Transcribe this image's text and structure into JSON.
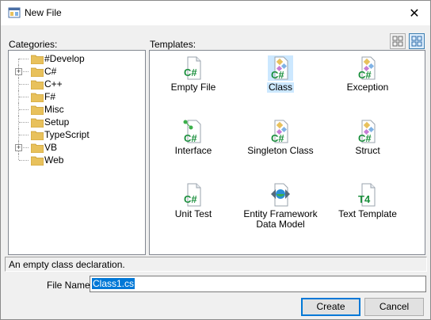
{
  "window": {
    "title": "New File",
    "close_glyph": "✕",
    "icon": "new-file-icon"
  },
  "categories": {
    "label": "Categories:",
    "items": [
      {
        "label": "#Develop",
        "expandable": false
      },
      {
        "label": "C#",
        "expandable": true
      },
      {
        "label": "C++",
        "expandable": false
      },
      {
        "label": "F#",
        "expandable": false
      },
      {
        "label": "Misc",
        "expandable": false
      },
      {
        "label": "Setup",
        "expandable": false
      },
      {
        "label": "TypeScript",
        "expandable": false
      },
      {
        "label": "VB",
        "expandable": true
      },
      {
        "label": "Web",
        "expandable": false
      }
    ]
  },
  "templates": {
    "label": "Templates:",
    "items": [
      {
        "name": "Empty File",
        "icon": "csharp-file-icon",
        "selected": false
      },
      {
        "name": "Class",
        "icon": "csharp-class-icon",
        "selected": true
      },
      {
        "name": "Exception",
        "icon": "csharp-class-icon",
        "selected": false
      },
      {
        "name": "Interface",
        "icon": "csharp-interface-icon",
        "selected": false
      },
      {
        "name": "Singleton Class",
        "icon": "csharp-class-icon",
        "selected": false
      },
      {
        "name": "Struct",
        "icon": "csharp-class-icon",
        "selected": false
      },
      {
        "name": "Unit Test",
        "icon": "csharp-file-icon",
        "selected": false
      },
      {
        "name": "Entity Framework Data Model",
        "name_line1": "Entity Framework",
        "name_line2": "Data Model",
        "icon": "entity-framework-icon",
        "selected": false
      },
      {
        "name": "Text Template",
        "icon": "t4-template-icon",
        "selected": false
      }
    ]
  },
  "view_buttons": {
    "large_icons": "large-icons-view-icon",
    "small_icons": "small-icons-view-icon"
  },
  "description": "An empty class declaration.",
  "file_name": {
    "label": "File Name",
    "value": "Class1.cs"
  },
  "buttons": {
    "create": "Create",
    "cancel": "Cancel"
  },
  "colors": {
    "selection": "#cce8ff",
    "accent": "#0078d7",
    "csharp_green": "#1a8f3c",
    "folder": "#e8c15c"
  }
}
